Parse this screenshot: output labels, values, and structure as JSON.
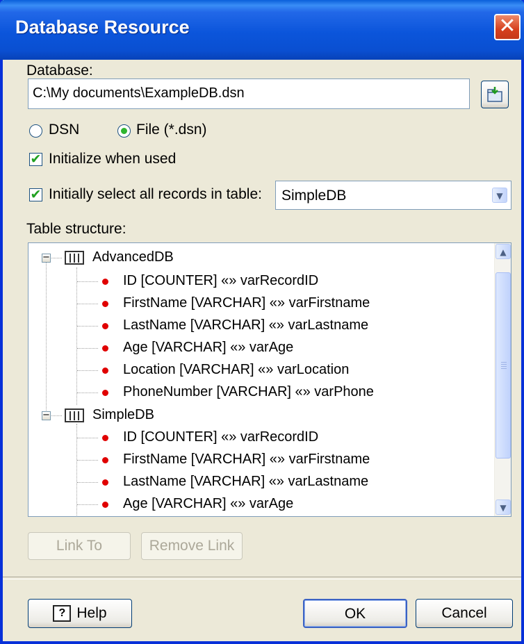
{
  "window": {
    "title": "Database Resource"
  },
  "database": {
    "label": "Database:",
    "value": "C:\\My documents\\ExampleDB.dsn"
  },
  "source_type": {
    "options": [
      "DSN",
      "File (*.dsn)"
    ],
    "selected": "File (*.dsn)"
  },
  "initialize": {
    "label": "Initialize when used",
    "checked": true
  },
  "initially_select": {
    "label": "Initially select all records in table:",
    "checked": true,
    "table_value": "SimpleDB"
  },
  "table_structure": {
    "label": "Table structure:",
    "tables": [
      {
        "name": "AdvancedDB",
        "fields": [
          "ID [COUNTER] «» varRecordID",
          "FirstName [VARCHAR] «» varFirstname",
          "LastName [VARCHAR] «» varLastname",
          "Age [VARCHAR] «» varAge",
          "Location [VARCHAR] «» varLocation",
          "PhoneNumber [VARCHAR] «» varPhone"
        ]
      },
      {
        "name": "SimpleDB",
        "fields": [
          "ID [COUNTER] «» varRecordID",
          "FirstName [VARCHAR] «» varFirstname",
          "LastName [VARCHAR] «» varLastname",
          "Age [VARCHAR] «» varAge"
        ]
      }
    ]
  },
  "buttons": {
    "link_to": "Link To",
    "remove_link": "Remove Link",
    "help": "Help",
    "ok": "OK",
    "cancel": "Cancel"
  },
  "icons": {
    "close": "close-icon",
    "browse": "open-folder-icon",
    "help": "question-mark-icon",
    "table": "table-icon",
    "field": "field-bullet-icon"
  },
  "colors": {
    "titlebar": "#0A55DB",
    "window_bg": "#ECE9D8",
    "close": "#D6401E",
    "field_bullet": "#E00000"
  }
}
